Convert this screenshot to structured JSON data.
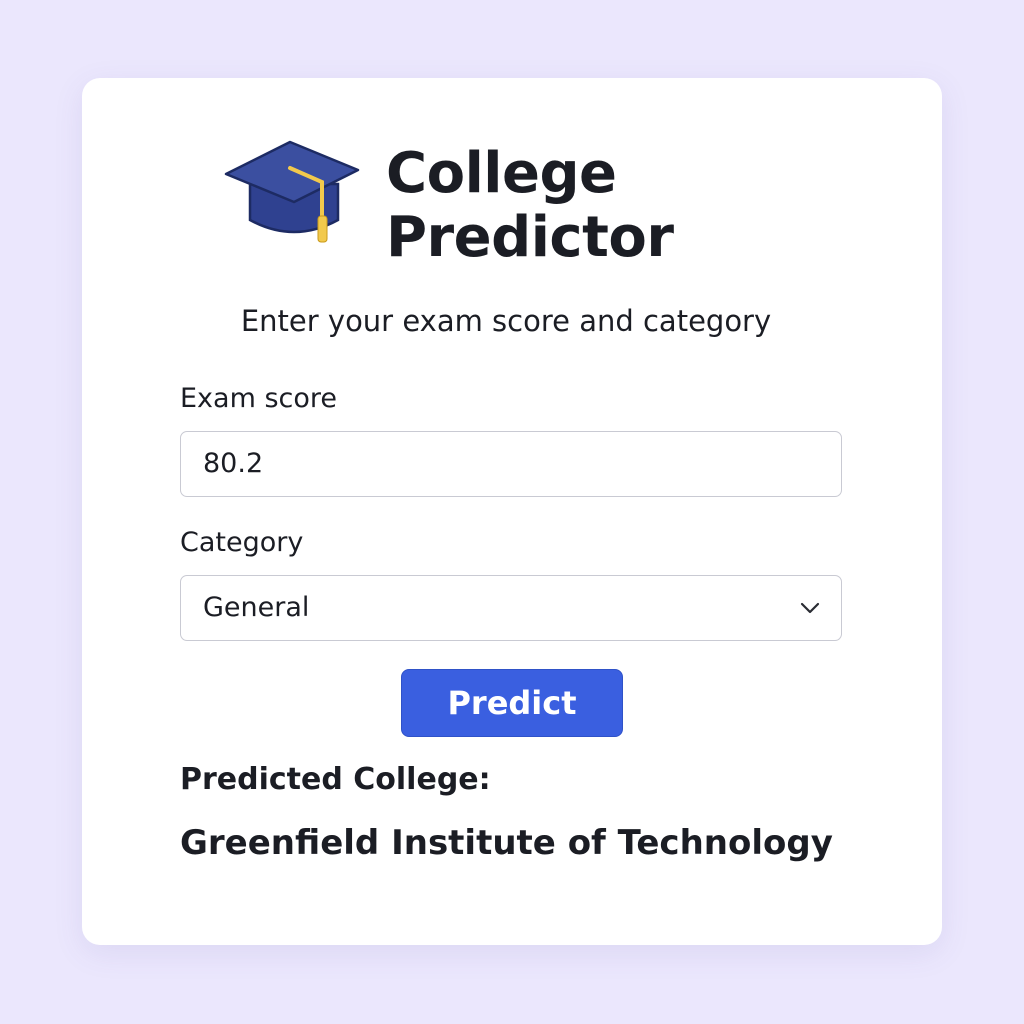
{
  "header": {
    "title_line1": "College",
    "title_line2": "Predictor",
    "icon": "graduation-cap-icon"
  },
  "subtitle": "Enter your exam score and category",
  "form": {
    "score_label": "Exam score",
    "score_value": "80.2",
    "category_label": "Category",
    "category_value": "General",
    "category_icon": "chevron-down-icon",
    "submit_label": "Predict"
  },
  "result": {
    "label": "Predicted College:",
    "value": "Greenfield Institute of Technology"
  },
  "colors": {
    "background": "#ebe7fd",
    "card": "#ffffff",
    "accent": "#3a5fe0",
    "cap": "#3b4fa0",
    "tassel": "#f2c94c",
    "text": "#1b1d24"
  }
}
